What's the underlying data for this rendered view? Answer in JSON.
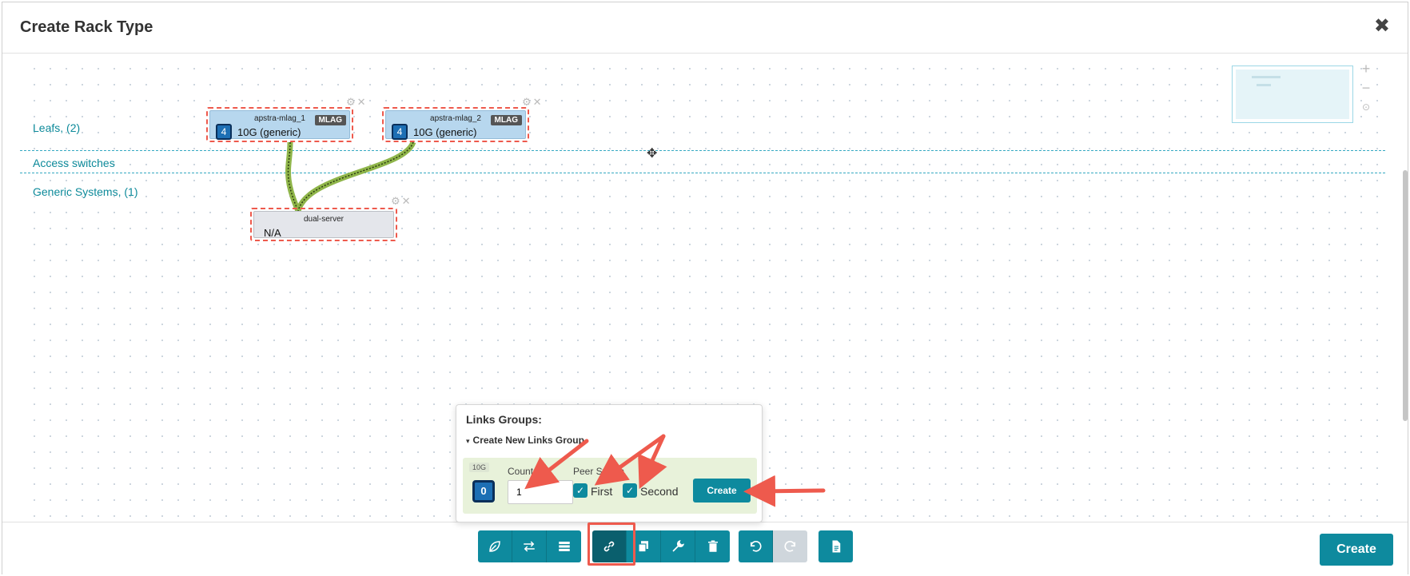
{
  "modal": {
    "title": "Create Rack Type",
    "close_glyph": "✖"
  },
  "rows": {
    "leafs": "Leafs, (2)",
    "access": "Access switches",
    "generic": "Generic Systems, (1)"
  },
  "nodes": {
    "leaf1": {
      "name": "apstra-mlag_1",
      "badge": "MLAG",
      "count": "4",
      "speed": "10G (generic)"
    },
    "leaf2": {
      "name": "apstra-mlag_2",
      "badge": "MLAG",
      "count": "4",
      "speed": "10G (generic)"
    },
    "server": {
      "name": "dual-server",
      "value": "N/A"
    },
    "tools_glyph": "⚙✕"
  },
  "zoom": {
    "plus": "+",
    "minus": "−",
    "reset": "⊙"
  },
  "move_glyph": "✥",
  "links_popover": {
    "title": "Links Groups:",
    "section": "Create New Links Group",
    "section_caret": "▾",
    "speed_tag": "10G",
    "current_count": "0",
    "count_label": "Count",
    "count_value": "1",
    "peer_label": "Peer Switch",
    "first_label": "First",
    "second_label": "Second",
    "check_glyph": "✓",
    "create_label": "Create"
  },
  "toolbar": {
    "groups": [
      [
        "leaf-icon",
        "swap-icon",
        "rows-icon"
      ],
      [
        "link-icon",
        "copy-icon",
        "wrench-icon",
        "trash-icon"
      ],
      [
        "undo-icon",
        "redo-icon"
      ],
      [
        "document-icon"
      ]
    ],
    "active": "link-icon",
    "disabled": [
      "redo-icon"
    ]
  },
  "footer": {
    "create_label": "Create"
  },
  "colors": {
    "accent": "#0e8a9e",
    "highlight": "#ee5a4d",
    "label": "#0d8a9a"
  }
}
